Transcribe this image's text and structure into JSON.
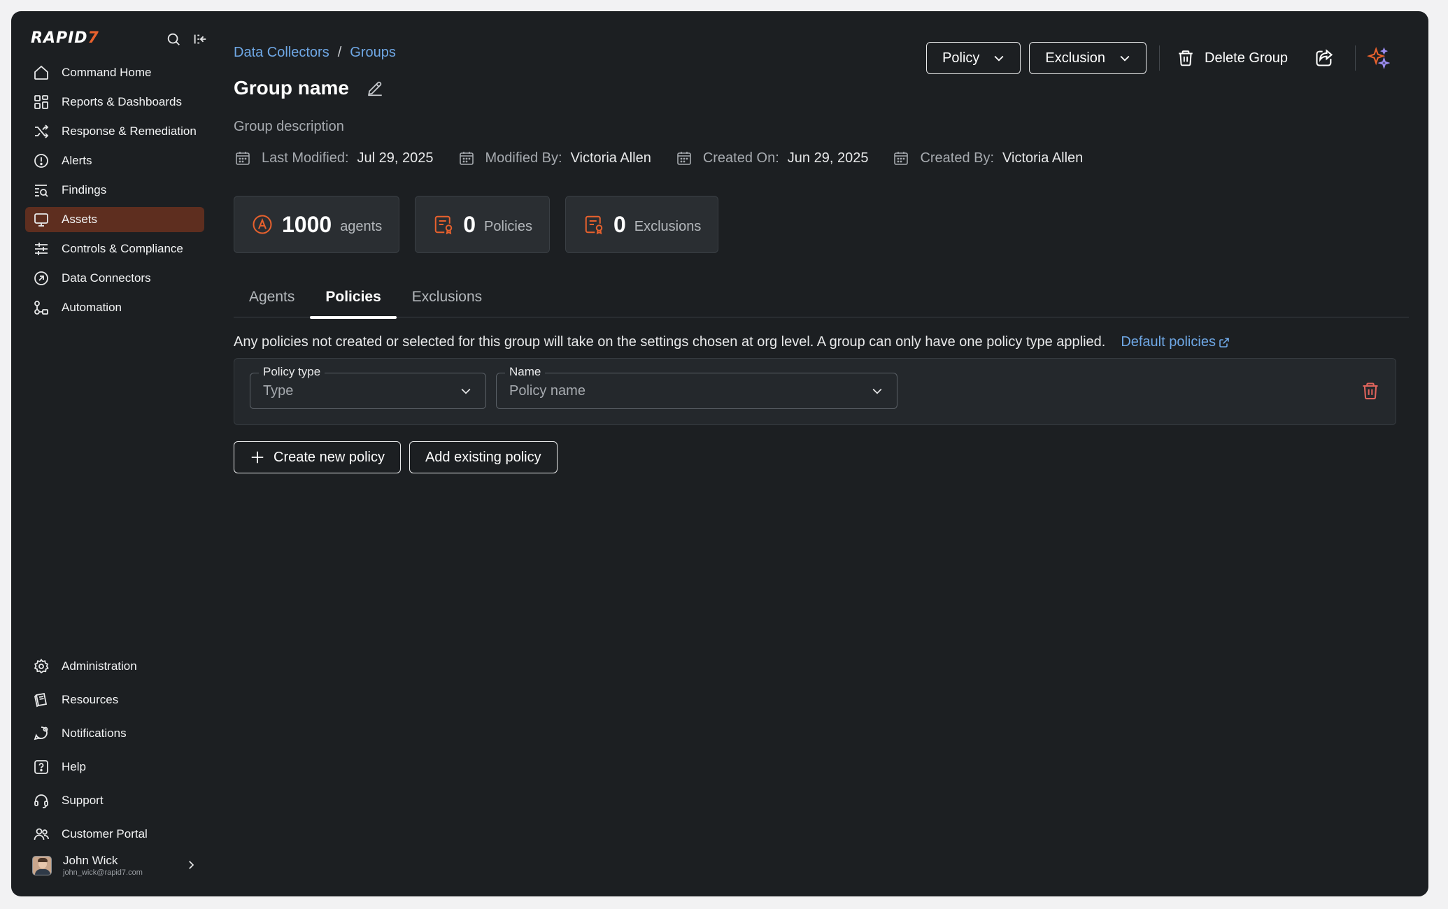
{
  "brand": {
    "logo_main": "RAPID",
    "logo_accent": "7"
  },
  "sidebar": {
    "items": [
      {
        "label": "Command Home",
        "icon": "home-icon"
      },
      {
        "label": "Reports & Dashboards",
        "icon": "dashboard-icon"
      },
      {
        "label": "Response & Remediation",
        "icon": "shuffle-icon"
      },
      {
        "label": "Alerts",
        "icon": "alert-icon"
      },
      {
        "label": "Findings",
        "icon": "findings-icon"
      },
      {
        "label": "Assets",
        "icon": "monitor-icon",
        "active": true
      },
      {
        "label": "Controls & Compliance",
        "icon": "sliders-icon"
      },
      {
        "label": "Data Connectors",
        "icon": "connector-icon"
      },
      {
        "label": "Automation",
        "icon": "automation-icon"
      }
    ],
    "bottom_items": [
      {
        "label": "Administration",
        "icon": "gear-icon"
      },
      {
        "label": "Resources",
        "icon": "resources-icon"
      },
      {
        "label": "Notifications",
        "icon": "bell-icon"
      },
      {
        "label": "Help",
        "icon": "help-icon"
      },
      {
        "label": "Support",
        "icon": "headset-icon"
      },
      {
        "label": "Customer Portal",
        "icon": "users-icon"
      }
    ],
    "user": {
      "name": "John Wick",
      "email": "john_wick@rapid7.com"
    }
  },
  "breadcrumb": {
    "parent": "Data Collectors",
    "separator": "/",
    "current": "Groups"
  },
  "page": {
    "title": "Group name",
    "description": "Group description"
  },
  "meta": [
    {
      "label": "Last Modified:",
      "value": "Jul 29, 2025"
    },
    {
      "label": "Modified By:",
      "value": "Victoria Allen"
    },
    {
      "label": "Created On:",
      "value": "Jun 29, 2025"
    },
    {
      "label": "Created By:",
      "value": "Victoria Allen"
    }
  ],
  "stats": [
    {
      "value": "1000",
      "unit": "agents"
    },
    {
      "value": "0",
      "unit": "Policies"
    },
    {
      "value": "0",
      "unit": "Exclusions"
    }
  ],
  "tabs": [
    {
      "label": "Agents"
    },
    {
      "label": "Policies",
      "active": true
    },
    {
      "label": "Exclusions"
    }
  ],
  "policies": {
    "info_text": "Any policies not created or selected for this group will take on the settings chosen at org level. A group can only have one policy type applied.",
    "default_link": "Default policies",
    "type_field": {
      "label": "Policy type",
      "placeholder": "Type"
    },
    "name_field": {
      "label": "Name",
      "placeholder": "Policy name"
    },
    "create_button": "Create new policy",
    "add_button": "Add existing policy"
  },
  "actions": {
    "policy_dropdown": "Policy",
    "exclusion_dropdown": "Exclusion",
    "delete_button": "Delete Group"
  },
  "colors": {
    "background": "#1c1f22",
    "accent": "#e8612d",
    "active_nav": "#5e2e1f",
    "link": "#6fa8e6",
    "danger": "#e0645c",
    "ai_sparkle": "#9b8cf0"
  }
}
